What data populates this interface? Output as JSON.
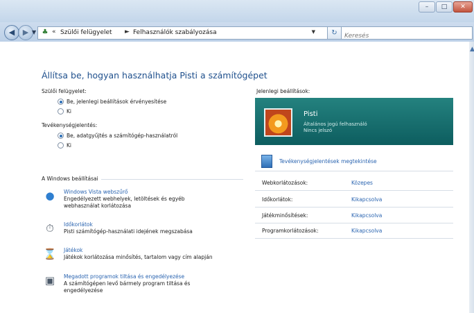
{
  "window": {
    "buttons": {
      "minimize": "–",
      "maximize": "□",
      "close": "✕"
    }
  },
  "nav": {
    "back_icon": "back-arrow-icon",
    "forward_icon": "forward-arrow-icon",
    "dropdown_icon": "chevron-down-icon",
    "refresh_symbol": "↻",
    "breadcrumb": [
      "Szülői felügyelet",
      "Felhasználók szabályozása"
    ],
    "breadcrumb_separator": "►",
    "search_placeholder": "Keresés"
  },
  "main": {
    "title": "Állítsa be, hogyan használhatja Pisti a számítógépet",
    "parental_control": {
      "label": "Szülői felügyelet:",
      "options": [
        "Be, jelenlegi beállítások érvényesítése",
        "Ki"
      ],
      "selected": 0
    },
    "activity_reporting": {
      "label": "Tevékenységjelentés:",
      "options": [
        "Be, adatgyűjtés a számítógép-használatról",
        "Ki"
      ],
      "selected": 0
    },
    "windows_settings": {
      "label": "A Windows beállításai",
      "items": [
        {
          "icon": "globe-icon",
          "link": "Windows Vista webszűrő",
          "desc": [
            "Engedélyezett webhelyek, letöltések és egyéb",
            "webhasználat korlátozása"
          ]
        },
        {
          "icon": "clock-icon",
          "link": "Időkorlátok",
          "desc": [
            "Pisti számítógép-használati idejének megszabása"
          ]
        },
        {
          "icon": "games-icon",
          "link": "Játékok",
          "desc": [
            "Játékok korlátozása minősítés, tartalom vagy cím alapján"
          ]
        },
        {
          "icon": "programs-icon",
          "link": "Megadott programok tiltása és engedélyezése",
          "desc": [
            "A számítógépen levő bármely program tiltása és",
            "engedélyezése"
          ]
        }
      ]
    }
  },
  "current": {
    "label": "Jelenlegi beállítások:",
    "user": {
      "name": "Pisti",
      "role": "Általános jogú felhasználó",
      "password": "Nincs jelszó"
    },
    "activity_link": "Tevékenységjelentések megtekintése",
    "limits": [
      {
        "label": "Webkorlátozások:",
        "value": "Közepes"
      },
      {
        "label": "Időkorlátok:",
        "value": "Kikapcsolva"
      },
      {
        "label": "Játékminősítések:",
        "value": "Kikapcsolva"
      },
      {
        "label": "Programkorlátozások:",
        "value": "Kikapcsolva"
      }
    ]
  },
  "colors": {
    "link": "#2a64b0",
    "title": "#1e4f8c",
    "panel": "#1a7374"
  }
}
